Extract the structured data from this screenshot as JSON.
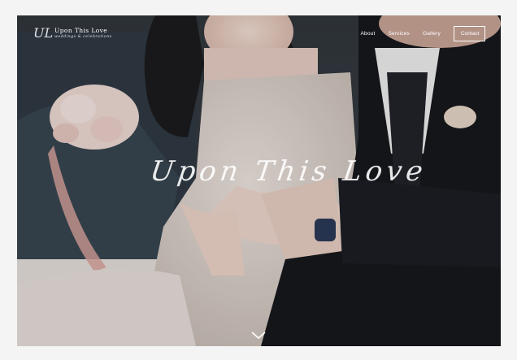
{
  "site": {
    "logo_mark": "UL",
    "name": "Upon This Love",
    "tagline": "weddings & celebrations"
  },
  "nav": {
    "items": [
      {
        "label": "About"
      },
      {
        "label": "Services"
      },
      {
        "label": "Gallery"
      }
    ],
    "contact_label": "Contact"
  },
  "hero": {
    "headline": "Upon This Love"
  },
  "icons": {
    "scroll": "chevron-down-icon"
  }
}
